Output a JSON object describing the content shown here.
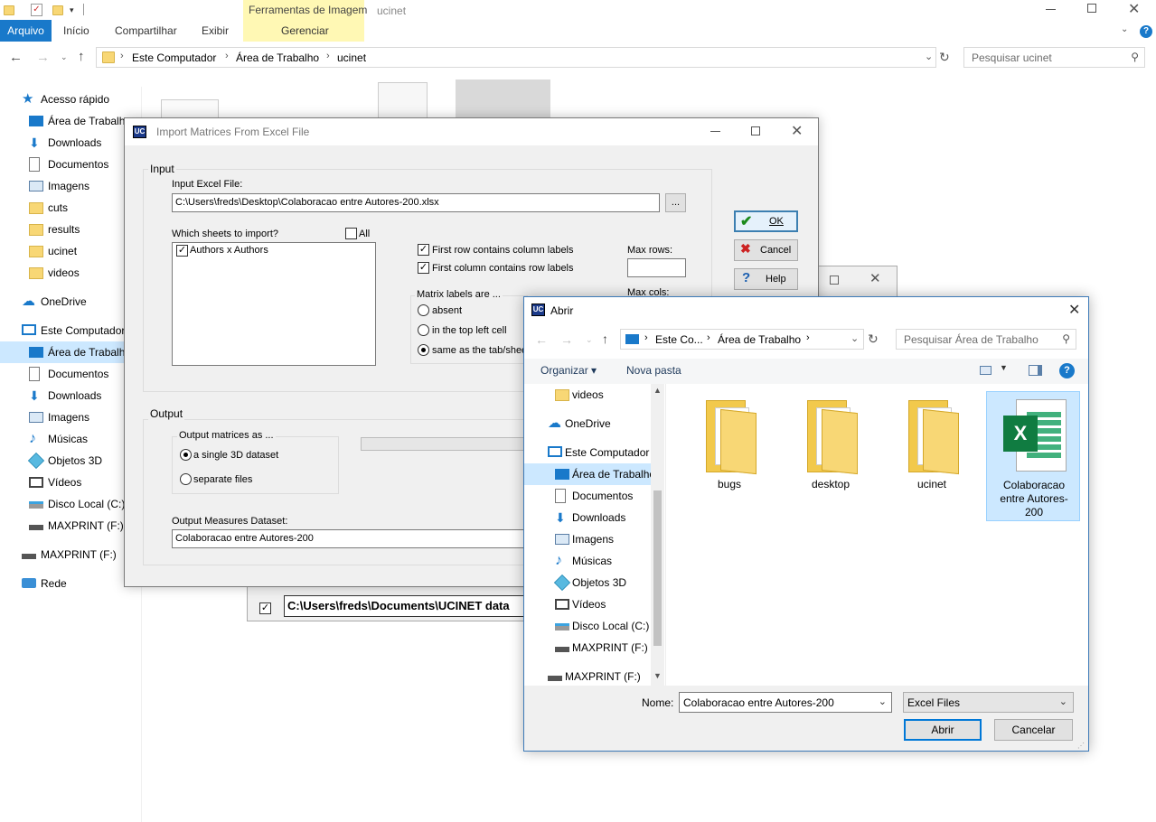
{
  "explorer": {
    "window_title": "ucinet",
    "ribbon_context_label": "Ferramentas de Imagem",
    "tabs": [
      "Arquivo",
      "Início",
      "Compartilhar",
      "Exibir",
      "Gerenciar"
    ],
    "address": {
      "segments": [
        "Este Computador",
        "Área de Trabalho",
        "ucinet"
      ]
    },
    "search_placeholder": "Pesquisar ucinet",
    "nav": [
      {
        "label": "Acesso rápido",
        "icon": "star-icon"
      },
      {
        "label": "Área de Trabalho",
        "icon": "desktop-icon"
      },
      {
        "label": "Downloads",
        "icon": "download-arrow-icon"
      },
      {
        "label": "Documentos",
        "icon": "document-icon"
      },
      {
        "label": "Imagens",
        "icon": "image-icon"
      },
      {
        "label": "cuts",
        "icon": "folder-icon"
      },
      {
        "label": "results",
        "icon": "folder-icon"
      },
      {
        "label": "ucinet",
        "icon": "folder-icon"
      },
      {
        "label": "videos",
        "icon": "folder-icon"
      },
      {
        "label": "OneDrive",
        "icon": "cloud-icon"
      },
      {
        "label": "Este Computador",
        "icon": "computer-icon"
      },
      {
        "label": "Área de Trabalho",
        "icon": "desktop-icon"
      },
      {
        "label": "Documentos",
        "icon": "document-icon"
      },
      {
        "label": "Downloads",
        "icon": "download-arrow-icon"
      },
      {
        "label": "Imagens",
        "icon": "image-icon"
      },
      {
        "label": "Músicas",
        "icon": "music-note-icon"
      },
      {
        "label": "Objetos 3D",
        "icon": "cube-icon"
      },
      {
        "label": "Vídeos",
        "icon": "film-icon"
      },
      {
        "label": "Disco Local (C:)",
        "icon": "drive-icon"
      },
      {
        "label": "MAXPRINT (F:)",
        "icon": "usb-drive-icon"
      },
      {
        "label": "MAXPRINT (F:)",
        "icon": "usb-drive-icon"
      },
      {
        "label": "Rede",
        "icon": "network-icon"
      }
    ]
  },
  "import_dialog": {
    "title": "Import Matrices From Excel File",
    "input_group": "Input",
    "input_file_label": "Input Excel File:",
    "input_file_value": "C:\\Users\\freds\\Desktop\\Colaboracao entre Autores-200.xlsx",
    "browse_label": "...",
    "sheets_label": "Which sheets to import?",
    "all_label": "All",
    "sheets": [
      "Authors x Authors"
    ],
    "first_row_label": "First row contains column labels",
    "first_col_label": "First column contains row labels",
    "max_rows_label": "Max rows:",
    "max_cols_label": "Max cols:",
    "matrix_labels_group": "Matrix labels are ...",
    "matrix_label_options": [
      "absent",
      "in the top left cell",
      "same as the tab/sheet"
    ],
    "output_group": "Output",
    "output_as_group": "Output matrices as ...",
    "output_options": [
      "a single 3D dataset",
      "separate files"
    ],
    "output_measures_label": "Output Measures Dataset:",
    "output_measures_value": "Colaboracao entre Autores-200",
    "ok_label": "OK",
    "cancel_label": "Cancel",
    "help_label": "Help"
  },
  "background_window": {
    "path_value": "C:\\Users\\freds\\Documents\\UCINET data"
  },
  "open_dialog": {
    "title": "Abrir",
    "address": [
      "Este Co...",
      "Área de Trabalho"
    ],
    "search_placeholder": "Pesquisar Área de Trabalho",
    "organize_label": "Organizar",
    "new_folder_label": "Nova pasta",
    "tree": [
      {
        "label": "videos",
        "icon": "folder-icon"
      },
      {
        "label": "OneDrive",
        "icon": "cloud-icon"
      },
      {
        "label": "Este Computador",
        "icon": "computer-icon"
      },
      {
        "label": "Área de Trabalho",
        "icon": "desktop-icon"
      },
      {
        "label": "Documentos",
        "icon": "document-icon"
      },
      {
        "label": "Downloads",
        "icon": "download-arrow-icon"
      },
      {
        "label": "Imagens",
        "icon": "image-icon"
      },
      {
        "label": "Músicas",
        "icon": "music-note-icon"
      },
      {
        "label": "Objetos 3D",
        "icon": "cube-icon"
      },
      {
        "label": "Vídeos",
        "icon": "film-icon"
      },
      {
        "label": "Disco Local (C:)",
        "icon": "drive-icon"
      },
      {
        "label": "MAXPRINT (F:)",
        "icon": "usb-drive-icon"
      },
      {
        "label": "MAXPRINT (F:)",
        "icon": "usb-drive-icon"
      }
    ],
    "files": [
      {
        "label": "bugs",
        "icon": "folder-icon"
      },
      {
        "label": "desktop",
        "icon": "folder-icon"
      },
      {
        "label": "ucinet",
        "icon": "folder-icon"
      },
      {
        "label": "Colaboracao entre Autores-200",
        "icon": "excel-file-icon"
      }
    ],
    "name_label": "Nome:",
    "name_value": "Colaboracao entre Autores-200",
    "filter_value": "Excel Files",
    "open_label": "Abrir",
    "cancel_label": "Cancelar"
  },
  "colors": {
    "accent": "#1979ca",
    "context_tab": "#fff8b4",
    "selected": "#cce8ff"
  }
}
